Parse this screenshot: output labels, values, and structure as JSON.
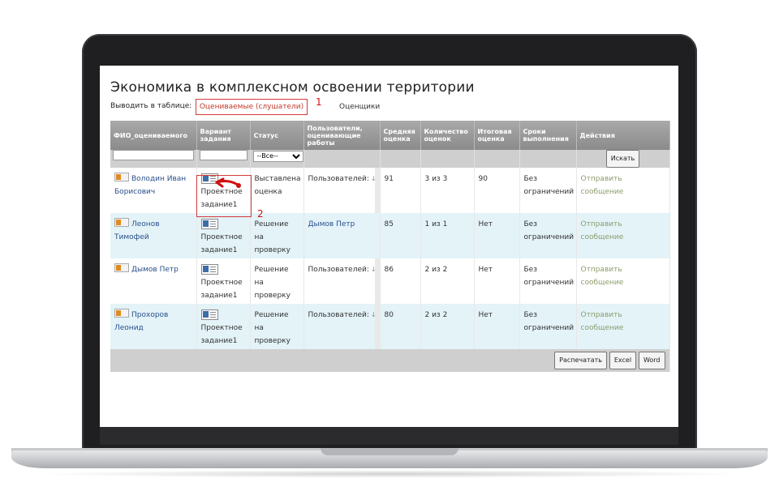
{
  "page": {
    "title": "Экономика в комплексном освоении территории",
    "display_label": "Выводить в таблице:",
    "tabs": [
      {
        "label": "Оцениваемые (слушатели)",
        "active": true
      },
      {
        "label": "Оценщики",
        "active": false
      }
    ]
  },
  "annotations": [
    "1",
    "2"
  ],
  "table": {
    "columns": [
      "ФИО_оцениваемого",
      "Вариант задания",
      "Статус",
      "Пользователи, оценивающие работы",
      "Средняя оценка",
      "Количество оценок",
      "Итоговая оценка",
      "Сроки выполнения",
      "Действия"
    ],
    "filter": {
      "status_option": "--Все--",
      "search_button": "Искать"
    },
    "rows": [
      {
        "name": "Володин Иван Борисович",
        "variant": "Проектное задание1",
        "status": "Выставлена оценка",
        "evaluators": "Пользователей:",
        "avg": "91",
        "count": "3 из 3",
        "final": "90",
        "deadline": "Без ограничений",
        "action": "Отправить сообщение"
      },
      {
        "name": "Леонов Тимофей",
        "variant": "Проектное задание1",
        "status": "Решение на проверку",
        "evaluators": "Дымов Петр",
        "avg": "85",
        "count": "1 из 1",
        "final": "Нет",
        "deadline": "Без ограничений",
        "action": "Отправить сообщение"
      },
      {
        "name": "Дымов Петр",
        "variant": "Проектное задание1",
        "status": "Решение на проверку",
        "evaluators": "Пользователей:",
        "avg": "86",
        "count": "2 из 2",
        "final": "Нет",
        "deadline": "Без ограничений",
        "action": "Отправить сообщение"
      },
      {
        "name": "Прохоров Леонид",
        "variant": "Проектное задание1",
        "status": "Решение на проверку",
        "evaluators": "Пользователей:",
        "avg": "80",
        "count": "2 из 2",
        "final": "Нет",
        "deadline": "Без ограничений",
        "action": "Отправить сообщение"
      }
    ],
    "footer_buttons": [
      "Распечатать",
      "Excel",
      "Word"
    ]
  },
  "colors": {
    "header_bg": "#999999",
    "alt_row": "#e3f3f8",
    "link": "#2a4f8a",
    "action_link": "#8c9c6b",
    "annotation_red": "#d63a3a"
  }
}
